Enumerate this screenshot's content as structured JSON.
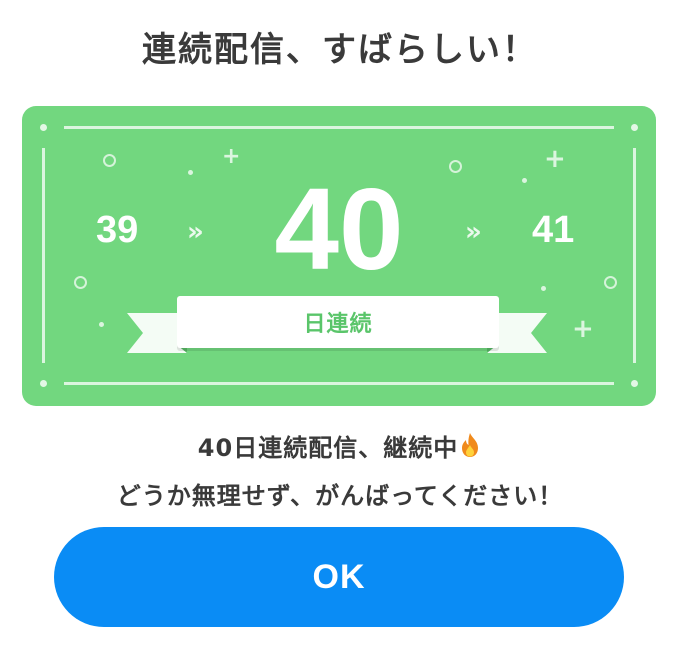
{
  "dialog": {
    "title": "連続配信、すばらしい！"
  },
  "streak_card": {
    "previous_day": "39",
    "current_day": "40",
    "next_day": "41",
    "next_arrow": "»",
    "banner_label": "日連続",
    "card_color": "#72d77f",
    "banner_text_color": "#5ac56a"
  },
  "message": {
    "line1": "40日連続配信、継続中",
    "line1_icon": "fire-icon",
    "line2": "どうか無理せず、がんばってください！"
  },
  "ok_button": {
    "label": "OK",
    "color": "#0a8cf5"
  }
}
